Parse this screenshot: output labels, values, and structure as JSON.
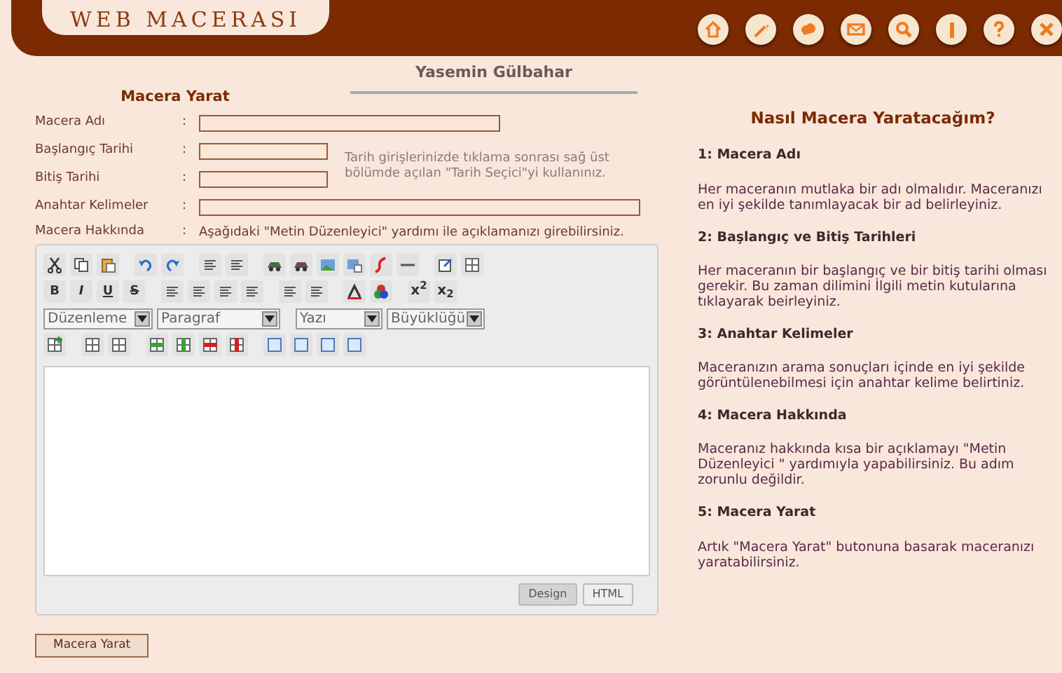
{
  "header": {
    "logo": "WEB MACERASI"
  },
  "tabs": [
    {
      "label": "Macera Yarat",
      "selected": true
    },
    {
      "label": "Yasemin Gülbahar",
      "selected": false
    }
  ],
  "form": {
    "fields": [
      {
        "label": "Macera Adı",
        "kind": "long"
      },
      {
        "label": "Başlangıç Tarihi",
        "kind": "short"
      },
      {
        "label": "Bitiş Tarihi",
        "kind": "short"
      },
      {
        "label": "Anahtar Kelimeler",
        "kind": "full"
      }
    ],
    "date_hint": "Tarih girişlerinizde tıklama sonrası sağ üst bölümde açılan \"Tarih Seçici\"yi kullanınız.",
    "about_label": "Macera Hakkında",
    "about_hint": "Aşağıdaki \"Metin Düzenleyici\" yardımı ile açıklamanızı girebilirsiniz.",
    "separator": ":"
  },
  "editor": {
    "format_buttons": [
      "B",
      "I",
      "U",
      "S"
    ],
    "script_buttons": [
      "x$^{2}$",
      "x$_{2}$"
    ],
    "dropdowns": [
      "Düzenleme",
      "Paragraf",
      "Yazı",
      "Büyüklüğü"
    ],
    "mode_tabs": [
      {
        "label": "Design",
        "selected": true
      },
      {
        "label": "HTML",
        "selected": false
      }
    ]
  },
  "submit": "Macera Yarat",
  "help": {
    "title": "Nasıl Macera Yaratacağım?",
    "steps": [
      {
        "heading": "1: Macera Adı",
        "text": "Her maceranın mutlaka bir adı olmalıdır. Maceranızı en iyi şekilde tanımlayacak bir ad belirleyiniz."
      },
      {
        "heading": "2: Başlangıç ve Bitiş Tarihleri",
        "text": "Her maceranın bir başlangıç ve bir bitiş tarihi olması gerekir. Bu zaman dilimini İlgili metin kutularına tıklayarak beirleyiniz."
      },
      {
        "heading": "3: Anahtar Kelimeler",
        "text": "Maceranızın arama sonuçları içinde en iyi şekilde görüntülenebilmesi için anahtar kelime belirtiniz."
      },
      {
        "heading": "4: Macera Hakkında",
        "text": "Maceranız hakkında kısa bir açıklamayı \"Metin Düzenleyici \" yardımıyla yapabilirsiniz. Bu adım zorunlu değildir."
      },
      {
        "heading": "5: Macera Yarat",
        "text": "Artık \"Macera Yarat\" butonuna basarak maceranızı yaratabilirsiniz."
      }
    ]
  }
}
